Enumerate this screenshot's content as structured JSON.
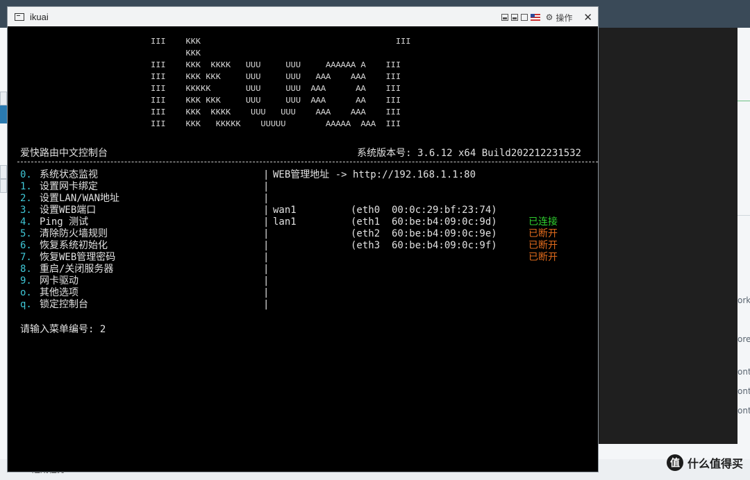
{
  "window": {
    "title": "ikuai",
    "operate_label": "操作"
  },
  "console": {
    "ascii_art": "III    KKK                                       III\n       KKK\nIII    KKK  KKKK   UUU     UUU     AAAAAA A    III\nIII    KKK KKK     UUU     UUU   AAA    AAA    III\nIII    KKKKK       UUU     UUU  AAA      AA    III\nIII    KKK KKK     UUU     UUU  AAA      AA    III\nIII    KKK  KKKK    UUU   UUU    AAA    AAA    III\nIII    KKK   KKKKK    UUUUU        AAAAA  AAA  III",
    "brand": "爱快路由中文控制台",
    "version": "系统版本号: 3.6.12 x64 Build202212231532",
    "menu": [
      {
        "key": "0.",
        "label": "系统状态监视"
      },
      {
        "key": "1.",
        "label": "设置网卡绑定"
      },
      {
        "key": "2.",
        "label": "设置LAN/WAN地址"
      },
      {
        "key": "3.",
        "label": "设置WEB端口"
      },
      {
        "key": "4.",
        "label": "Ping 测试"
      },
      {
        "key": "5.",
        "label": "清除防火墙规则"
      },
      {
        "key": "6.",
        "label": "恢复系统初始化"
      },
      {
        "key": "7.",
        "label": "恢复WEB管理密码"
      },
      {
        "key": "8.",
        "label": "重启/关闭服务器"
      },
      {
        "key": "9.",
        "label": "网卡驱动"
      },
      {
        "key": "o.",
        "label": "其他选项"
      },
      {
        "key": "q.",
        "label": "锁定控制台"
      }
    ],
    "separator": "|",
    "web_address": "WEB管理地址 -> http://192.168.1.1:80",
    "interfaces": [
      {
        "name": "",
        "eth": "(eth0  00:0c:29:bf:23:74)",
        "status": "已连接",
        "state": "connected"
      },
      {
        "name": "wan1",
        "eth": "(eth1  60:be:b4:09:0c:9d)",
        "status": "已断开",
        "state": "disconnected"
      },
      {
        "name": "lan1",
        "eth": "(eth2  60:be:b4:09:0c:9e)",
        "status": "已断开",
        "state": "disconnected"
      },
      {
        "name": "",
        "eth": "(eth3  60:be:b4:09:0c:9f)",
        "status": "已断开",
        "state": "disconnected"
      }
    ],
    "prompt": "请输入菜单编号: 2"
  },
  "background": {
    "right_texts": [
      "ork (",
      "ore",
      "ont",
      "ont",
      "ont"
    ],
    "bottom_text": "运期任务"
  },
  "watermark": {
    "logo_char": "值",
    "text": "什么值得买"
  },
  "colors": {
    "menu_key": "#3fc7d6",
    "connected": "#2fd02f",
    "disconnected": "#e06a1c"
  }
}
